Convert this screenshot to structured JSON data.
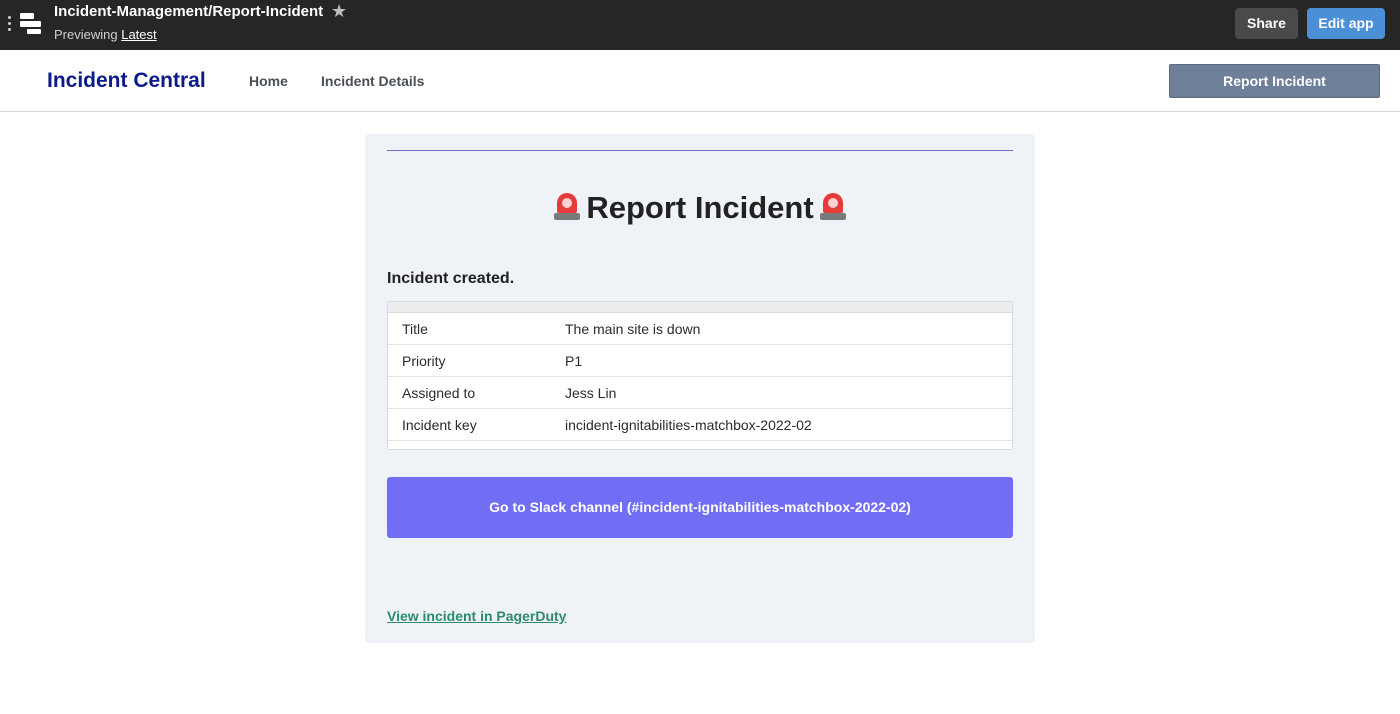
{
  "topbar": {
    "app_path": "Incident-Management/Report-Incident",
    "previewing_label": "Previewing",
    "version_link": "Latest",
    "share_label": "Share",
    "edit_label": "Edit app",
    "star_icon": "star-icon",
    "menu_icon": "kebab-menu-icon"
  },
  "nav": {
    "brand": "Incident Central",
    "links": [
      {
        "label": "Home"
      },
      {
        "label": "Incident Details"
      }
    ],
    "report_button": "Report Incident"
  },
  "card": {
    "title": "Report Incident",
    "title_icon": "siren-icon",
    "created_message": "Incident created.",
    "rows": [
      {
        "key": "Title",
        "value": "The main site is down"
      },
      {
        "key": "Priority",
        "value": "P1"
      },
      {
        "key": "Assigned to",
        "value": "Jess Lin"
      },
      {
        "key": "Incident key",
        "value": "incident-ignitabilities-matchbox-2022-02"
      }
    ],
    "slack_button": "Go to Slack channel (#incident-ignitabilities-matchbox-2022-02)",
    "pagerduty_link": "View incident in PagerDuty"
  },
  "colors": {
    "topbar_bg": "#262626",
    "brand": "#0d1a8a",
    "edit_button": "#4b8fd6",
    "report_button": "#6e7f99",
    "slack_button": "#716ef5",
    "link": "#2e8a6c",
    "card_bg": "#eff2f7"
  }
}
